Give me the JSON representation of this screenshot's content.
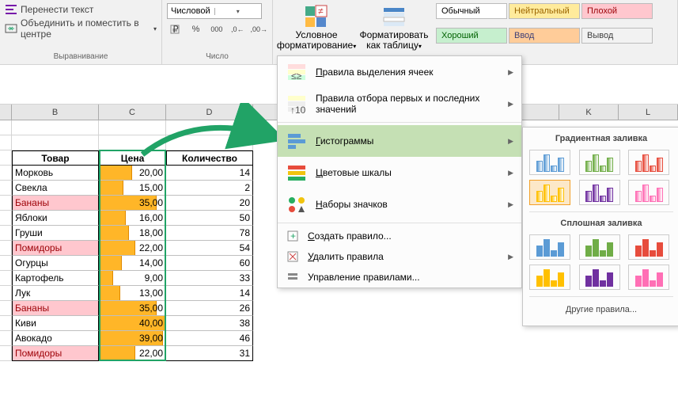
{
  "ribbon": {
    "align": {
      "wrap": "Перенести текст",
      "merge": "Объединить и поместить в центре",
      "label": "Выравнивание"
    },
    "number": {
      "format": "Числовой",
      "label": "Число"
    },
    "condfmt": {
      "label": "Условное форматирование"
    },
    "fmttable": {
      "label": "Форматировать как таблицу"
    },
    "styles": {
      "normal": "Обычный",
      "neutral": "Нейтральный",
      "bad": "Плохой",
      "good": "Хороший",
      "input": "Ввод",
      "output": "Вывод"
    }
  },
  "cols": {
    "B": "B",
    "C": "C",
    "D": "D",
    "K": "K",
    "L": "L"
  },
  "headers": {
    "tovar": "Товар",
    "price": "Цена",
    "qty": "Количество"
  },
  "chart_data": {
    "type": "table",
    "columns": [
      "Товар",
      "Цена",
      "Количество"
    ],
    "rows": [
      {
        "tovar": "Морковь",
        "price": "20,00",
        "qty": 14,
        "barPct": 50,
        "hl": false
      },
      {
        "tovar": "Свекла",
        "price": "15,00",
        "qty": 2,
        "barPct": 37,
        "hl": false
      },
      {
        "tovar": "Бананы",
        "price": "35,00",
        "qty": 20,
        "barPct": 87,
        "hl": true
      },
      {
        "tovar": "Яблоки",
        "price": "16,00",
        "qty": 50,
        "barPct": 40,
        "hl": false
      },
      {
        "tovar": "Груши",
        "price": "18,00",
        "qty": 78,
        "barPct": 45,
        "hl": false
      },
      {
        "tovar": "Помидоры",
        "price": "22,00",
        "qty": 54,
        "barPct": 55,
        "hl": true
      },
      {
        "tovar": "Огурцы",
        "price": "14,00",
        "qty": 60,
        "barPct": 35,
        "hl": false
      },
      {
        "tovar": "Картофель",
        "price": "9,00",
        "qty": 33,
        "barPct": 22,
        "hl": false
      },
      {
        "tovar": "Лук",
        "price": "13,00",
        "qty": 14,
        "barPct": 32,
        "hl": false
      },
      {
        "tovar": "Бананы",
        "price": "35,00",
        "qty": 26,
        "barPct": 87,
        "hl": true
      },
      {
        "tovar": "Киви",
        "price": "40,00",
        "qty": 38,
        "barPct": 100,
        "hl": false
      },
      {
        "tovar": "Авокадо",
        "price": "39,00",
        "qty": 46,
        "barPct": 97,
        "hl": false
      },
      {
        "tovar": "Помидоры",
        "price": "22,00",
        "qty": 31,
        "barPct": 55,
        "hl": true
      }
    ]
  },
  "menu": {
    "highlight": "Правила выделения ячеек",
    "toprules": "Правила отбора первых и последних значений",
    "databars": "Гистограммы",
    "colorscales": "Цветовые шкалы",
    "iconsets": "Наборы значков",
    "newrule": "Создать правило...",
    "clear": "Удалить правила",
    "manage": "Управление правилами..."
  },
  "submenu": {
    "gradient": "Градиентная заливка",
    "solid": "Сплошная заливка",
    "more": "Другие правила..."
  }
}
